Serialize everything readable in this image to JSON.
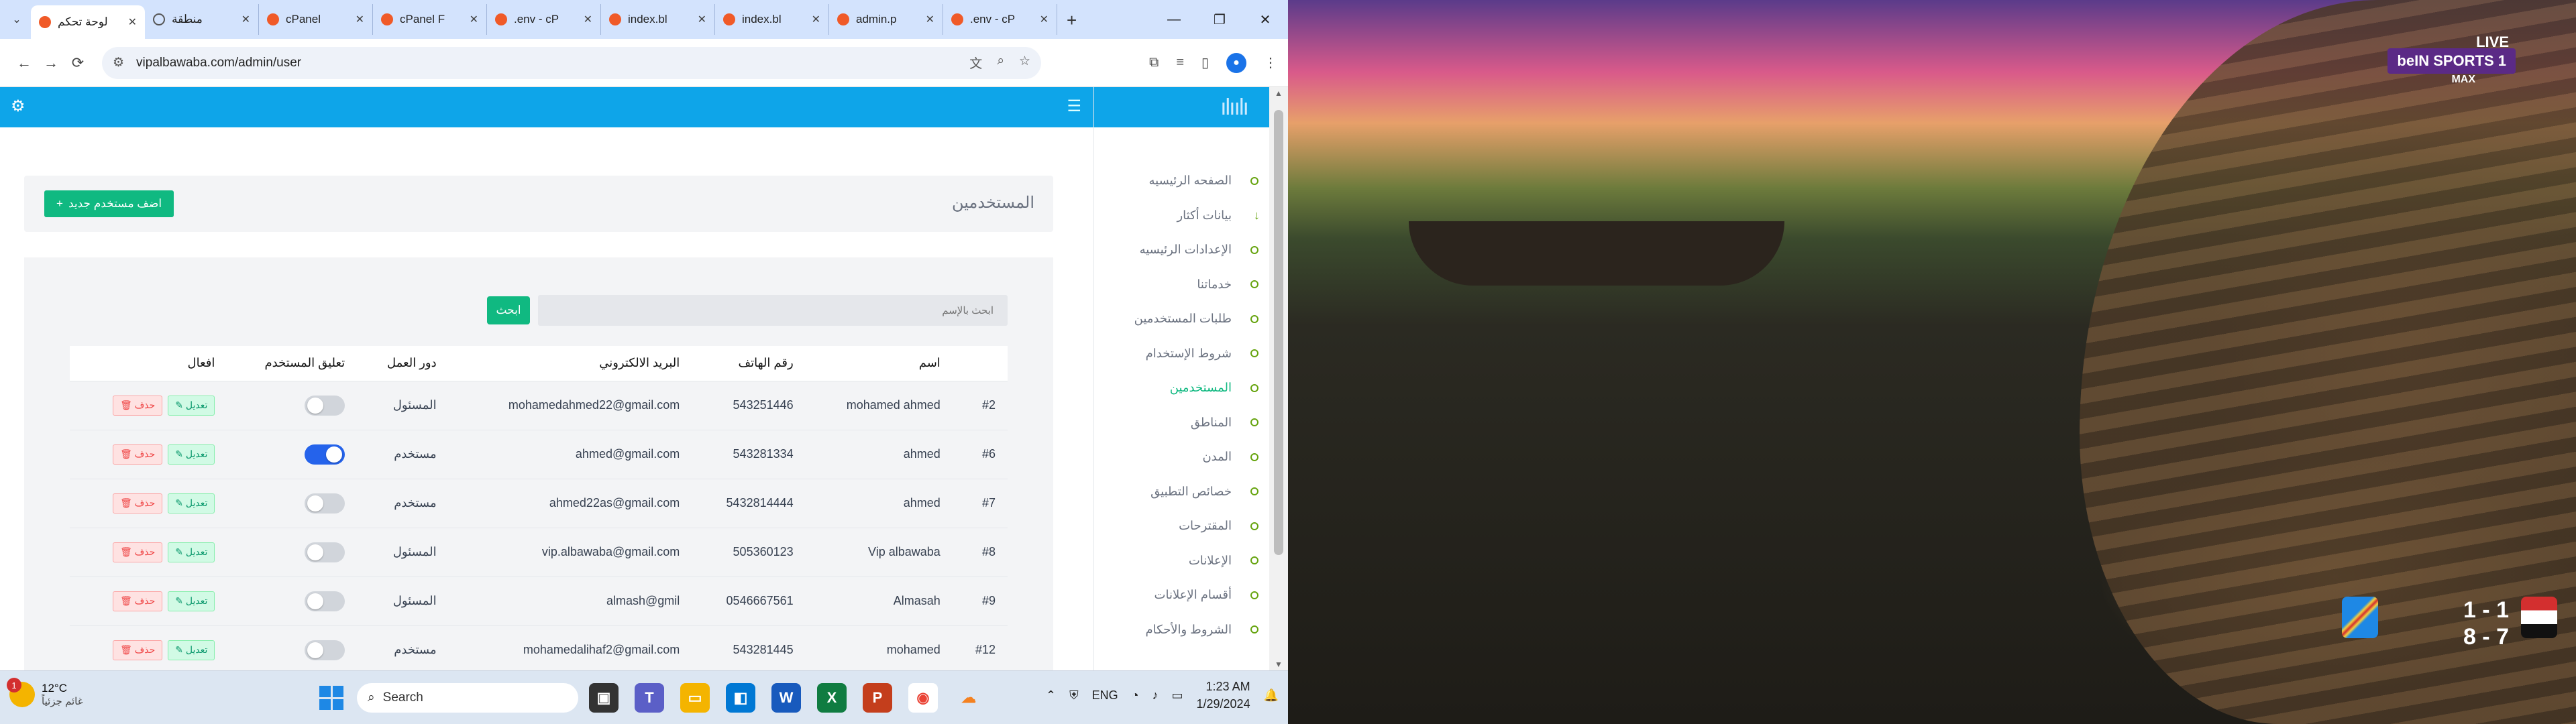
{
  "browser": {
    "tabs": [
      {
        "title": "لوحة تحكم",
        "active": true,
        "icon": "app-icon"
      },
      {
        "title": "منطقة",
        "active": false,
        "icon": "globe-icon"
      },
      {
        "title": "cPanel",
        "active": false,
        "icon": "cpanel-icon"
      },
      {
        "title": "cPanel F",
        "active": false,
        "icon": "cpanel-icon"
      },
      {
        "title": ".env - cP",
        "active": false,
        "icon": "cpanel-icon"
      },
      {
        "title": "index.bl",
        "active": false,
        "icon": "cpanel-icon"
      },
      {
        "title": "index.bl",
        "active": false,
        "icon": "cpanel-icon"
      },
      {
        "title": "admin.p",
        "active": false,
        "icon": "cpanel-icon"
      },
      {
        "title": ".env - cP",
        "active": false,
        "icon": "cpanel-icon"
      }
    ],
    "url": "vipalbawaba.com/admin/user"
  },
  "sidebar": {
    "logo": "ılıılı",
    "items": [
      {
        "label": "الصفحه الرئيسيه",
        "active": false
      },
      {
        "label": "بيانات أكثار",
        "active": false,
        "arrow": true
      },
      {
        "label": "الإعدادات الرئيسيه",
        "active": false
      },
      {
        "label": "خدماتنا",
        "active": false
      },
      {
        "label": "طلبات المستخدمين",
        "active": false
      },
      {
        "label": "شروط الإستخدام",
        "active": false
      },
      {
        "label": "المستخدمين",
        "active": true
      },
      {
        "label": "المناطق",
        "active": false
      },
      {
        "label": "المدن",
        "active": false
      },
      {
        "label": "خصائص التطبيق",
        "active": false
      },
      {
        "label": "المقترحات",
        "active": false
      },
      {
        "label": "الإعلانات",
        "active": false
      },
      {
        "label": "أقسام الإعلانات",
        "active": false
      },
      {
        "label": "الشروط والأحكام",
        "active": false
      }
    ]
  },
  "page": {
    "title": "المستخدمين",
    "add_button": "اضف مستخدم جديد",
    "add_icon": "+",
    "search_placeholder": "ابحث بالإسم",
    "search_button": "ابحث"
  },
  "table": {
    "headers": [
      "",
      "اسم",
      "رقم الهاتف",
      "البريد الالكتروني",
      "دور العمل",
      "تعليق المستخدم",
      "افعال"
    ],
    "edit_label": "✎ تعديل",
    "delete_label": "🗑 حذف",
    "rows": [
      {
        "id": "#2",
        "name": "mohamed ahmed",
        "phone": "543251446",
        "email": "mohamedahmed22@gmail.com",
        "role": "المسئول",
        "suspended": false
      },
      {
        "id": "#6",
        "name": "ahmed",
        "phone": "543281334",
        "email": "ahmed@gmail.com",
        "role": "مستخدم",
        "suspended": true
      },
      {
        "id": "#7",
        "name": "ahmed",
        "phone": "5432814444",
        "email": "ahmed22as@gmail.com",
        "role": "مستخدم",
        "suspended": false
      },
      {
        "id": "#8",
        "name": "Vip albawaba",
        "phone": "505360123",
        "email": "vip.albawaba@gmail.com",
        "role": "المسئول",
        "suspended": false
      },
      {
        "id": "#9",
        "name": "Almasah",
        "phone": "0546667561",
        "email": "almash@gmil",
        "role": "المسئول",
        "suspended": false
      },
      {
        "id": "#12",
        "name": "mohamed",
        "phone": "543281445",
        "email": "mohamedalihaf2@gmail.com",
        "role": "مستخدم",
        "suspended": false
      }
    ]
  },
  "taskbar": {
    "weather_temp": "12°C",
    "weather_desc": "غائم جزئياً",
    "notification_count": "1",
    "search_label": "Search",
    "language": "ENG",
    "time": "1:23 AM",
    "date": "1/29/2024"
  },
  "video": {
    "live": "LIVE",
    "channel": "beIN SPORTS 1",
    "channel_suffix": "MAX",
    "score_line1": "1 - 1",
    "score_line2": "8 - 7"
  }
}
